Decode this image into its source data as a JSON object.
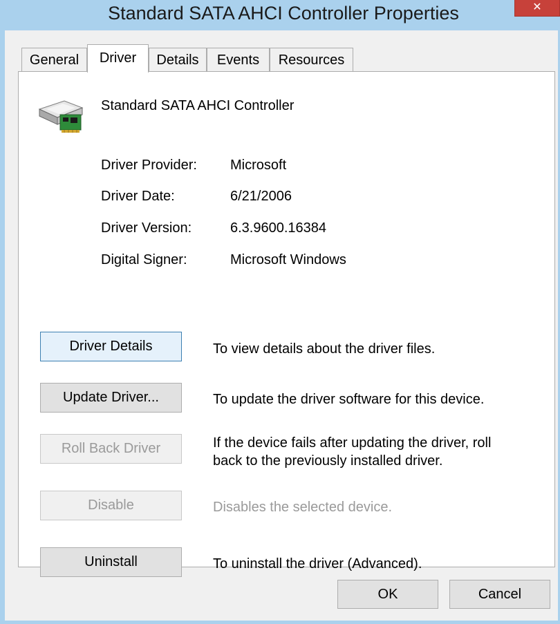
{
  "window": {
    "title": "Standard SATA AHCI Controller Properties",
    "close_glyph": "✕"
  },
  "tabs": [
    {
      "label": "General"
    },
    {
      "label": "Driver"
    },
    {
      "label": "Details"
    },
    {
      "label": "Events"
    },
    {
      "label": "Resources"
    }
  ],
  "active_tab": "Driver",
  "device": {
    "name": "Standard SATA AHCI Controller",
    "icon": "storage-controller-icon"
  },
  "info": {
    "provider": {
      "label": "Driver Provider:",
      "value": "Microsoft"
    },
    "date": {
      "label": "Driver Date:",
      "value": "6/21/2006"
    },
    "version": {
      "label": "Driver Version:",
      "value": "6.3.9600.16384"
    },
    "signer": {
      "label": "Digital Signer:",
      "value": "Microsoft Windows"
    }
  },
  "actions": {
    "details": {
      "label": "Driver Details",
      "description": "To view details about the driver files."
    },
    "update": {
      "label": "Update Driver...",
      "description": "To update the driver software for this device."
    },
    "rollback": {
      "label": "Roll Back Driver",
      "description_line1": "If the device fails after updating the driver, roll",
      "description_line2": "back to the previously installed driver."
    },
    "disable": {
      "label": "Disable",
      "description": "Disables the selected device."
    },
    "uninstall": {
      "label": "Uninstall",
      "description": "To uninstall the driver (Advanced)."
    }
  },
  "dialog": {
    "ok_label": "OK",
    "cancel_label": "Cancel"
  },
  "colors": {
    "title_bar": "#aad1ed",
    "close_button": "#c7413a",
    "focus_border": "#3c7fb1",
    "disabled_text": "#9a9a9a"
  }
}
